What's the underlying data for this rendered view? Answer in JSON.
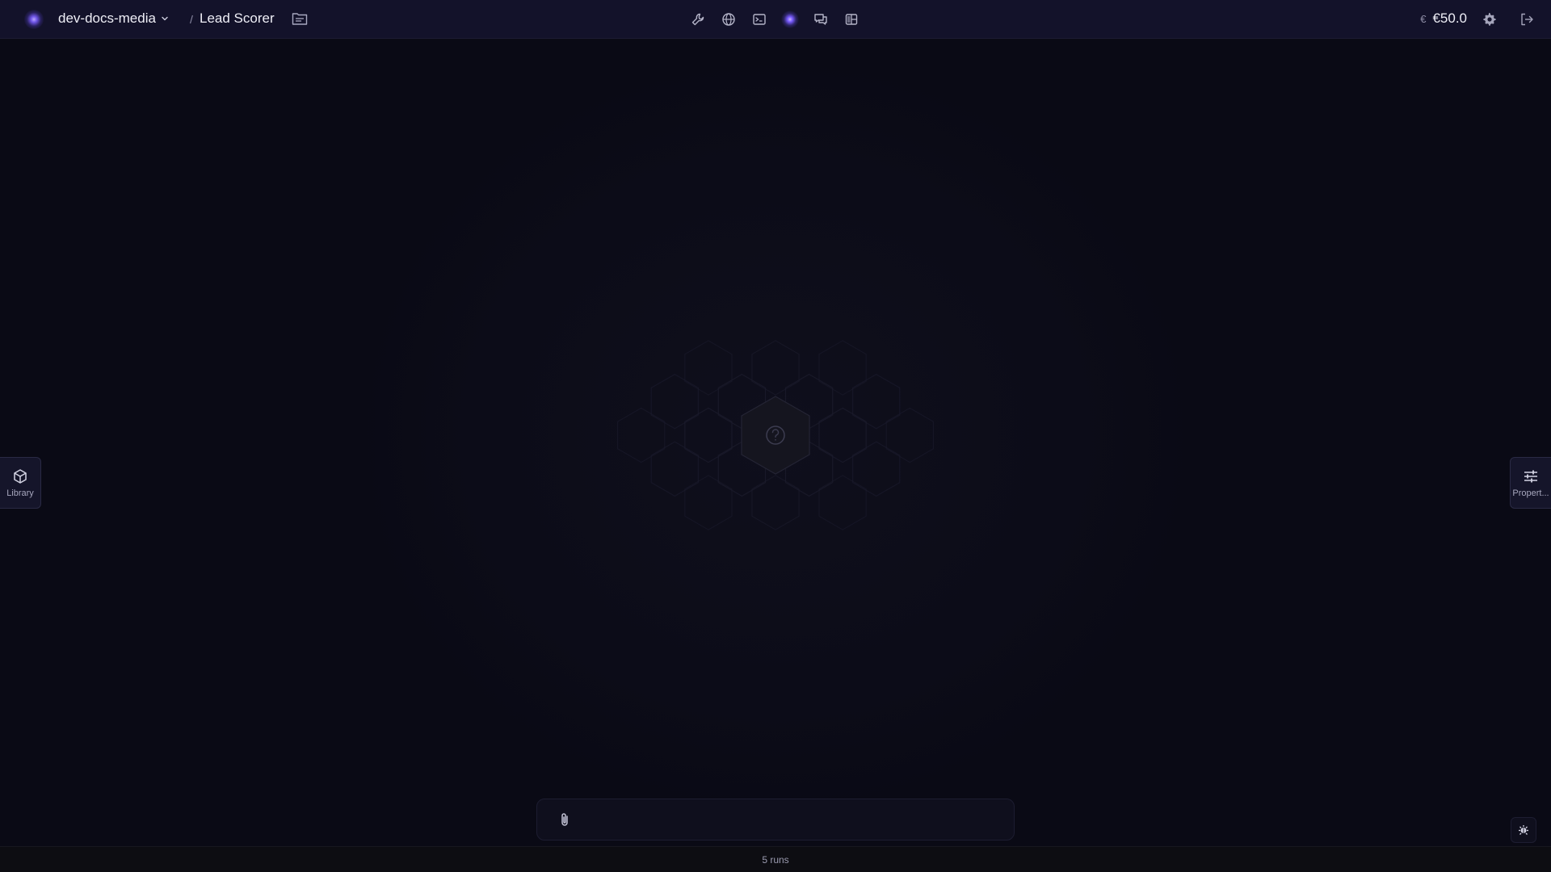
{
  "header": {
    "workspace_name": "dev-docs-media",
    "breadcrumb_separator": "/",
    "project_name": "Lead Scorer",
    "toolbar_icons": [
      "wrench-icon",
      "globe-icon",
      "terminal-icon",
      "orb-icon",
      "chat-icon",
      "layout-icon"
    ],
    "credits": {
      "currency_icon": "€",
      "amount": "€50.0"
    }
  },
  "side_panels": {
    "left_label": "Library",
    "right_label": "Propert..."
  },
  "chat": {
    "value": "",
    "placeholder": ""
  },
  "status": {
    "runs": "5 runs"
  },
  "colors": {
    "background": "#0b0b16",
    "topbar": "#13122a",
    "accent": "#7a5cff"
  }
}
